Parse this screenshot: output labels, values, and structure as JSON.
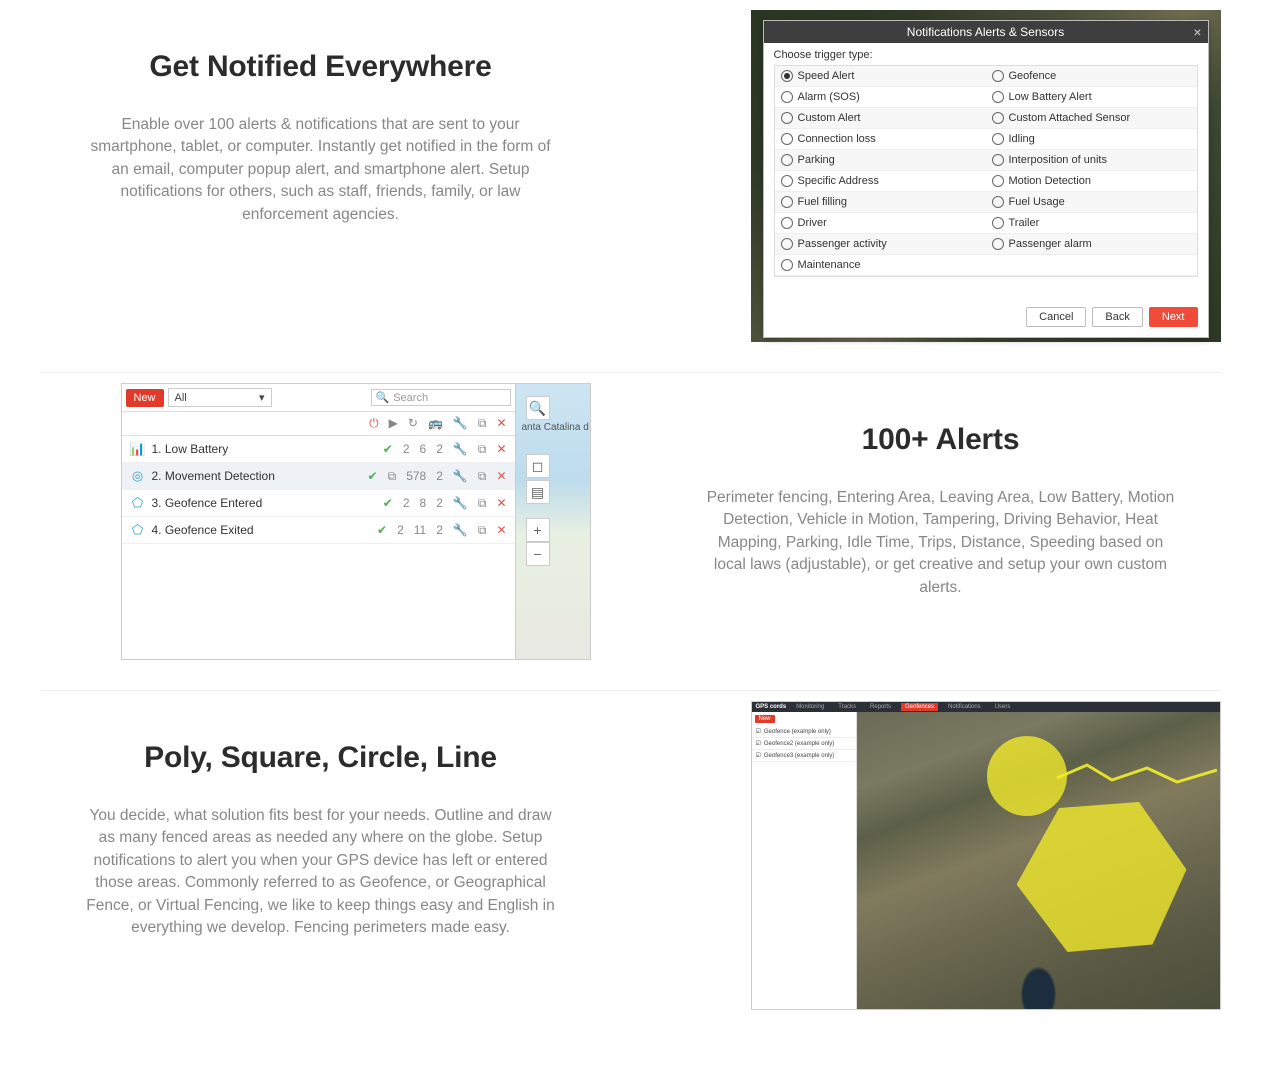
{
  "section1": {
    "title": "Get Notified Everywhere",
    "body": "Enable over 100 alerts & notifications that are sent to your smartphone, tablet, or computer. Instantly get notified in the form of an email, computer popup alert, and smartphone alert. Setup notifications for others, such as staff, friends, family, or law enforcement agencies.",
    "dialog": {
      "title": "Notifications Alerts & Sensors",
      "choose": "Choose trigger type:",
      "buttons": {
        "cancel": "Cancel",
        "back": "Back",
        "next": "Next"
      },
      "triggers": [
        {
          "label": "Speed Alert",
          "selected": true
        },
        {
          "label": "Geofence"
        },
        {
          "label": "Alarm (SOS)"
        },
        {
          "label": "Low Battery Alert"
        },
        {
          "label": "Custom Alert"
        },
        {
          "label": "Custom Attached Sensor"
        },
        {
          "label": "Connection loss"
        },
        {
          "label": "Idling"
        },
        {
          "label": "Parking"
        },
        {
          "label": "Interposition of units"
        },
        {
          "label": "Specific Address"
        },
        {
          "label": "Motion Detection"
        },
        {
          "label": "Fuel filling"
        },
        {
          "label": "Fuel Usage"
        },
        {
          "label": "Driver"
        },
        {
          "label": "Trailer"
        },
        {
          "label": "Passenger activity"
        },
        {
          "label": "Passenger alarm"
        },
        {
          "label": "Maintenance"
        }
      ]
    }
  },
  "section2": {
    "title": "100+ Alerts",
    "body": "Perimeter fencing, Entering Area, Leaving Area, Low Battery, Motion Detection, Vehicle in Motion, Tampering, Driving Behavior, Heat Mapping, Parking, Idle Time, Trips, Distance, Speeding based on local laws (adjustable), or get creative and setup your own custom alerts.",
    "panel": {
      "new": "New",
      "filter": "All",
      "search_placeholder": "Search",
      "map_label": "anta Catalina\nd",
      "rows": [
        {
          "icon": "📊",
          "name": "1. Low Battery",
          "c1": "2",
          "c2": "6",
          "c3": "2",
          "active": false,
          "extra": null
        },
        {
          "icon": "◎",
          "name": "2. Movement Detection",
          "c1": "",
          "c2": "578",
          "c3": "2",
          "active": true,
          "extra": "⧉"
        },
        {
          "icon": "⬠",
          "name": "3. Geofence Entered",
          "c1": "2",
          "c2": "8",
          "c3": "2",
          "active": false,
          "extra": null
        },
        {
          "icon": "⬠",
          "name": "4. Geofence Exited",
          "c1": "2",
          "c2": "11",
          "c3": "2",
          "active": false,
          "extra": null
        }
      ]
    }
  },
  "section3": {
    "title": "Poly, Square, Circle, Line",
    "body": "You decide, what solution fits best for your needs. Outline and draw as many fenced areas as needed any where on the globe. Setup notifications to alert you when your GPS device has left or entered those areas. Commonly referred to as Geofence, or Geographical Fence, or Virtual Fencing, we like to keep things easy and English in everything we develop. Fencing perimeters made easy.",
    "geo": {
      "logo": "GPS cords",
      "tabs": [
        "Monitoring",
        "Tracks",
        "Reports",
        "Geofences",
        "Notifications",
        "Users"
      ],
      "new": "New",
      "items": [
        "Geofence (example only)",
        "Geofence2 (example only)",
        "Geofence3 (example only)"
      ]
    }
  }
}
